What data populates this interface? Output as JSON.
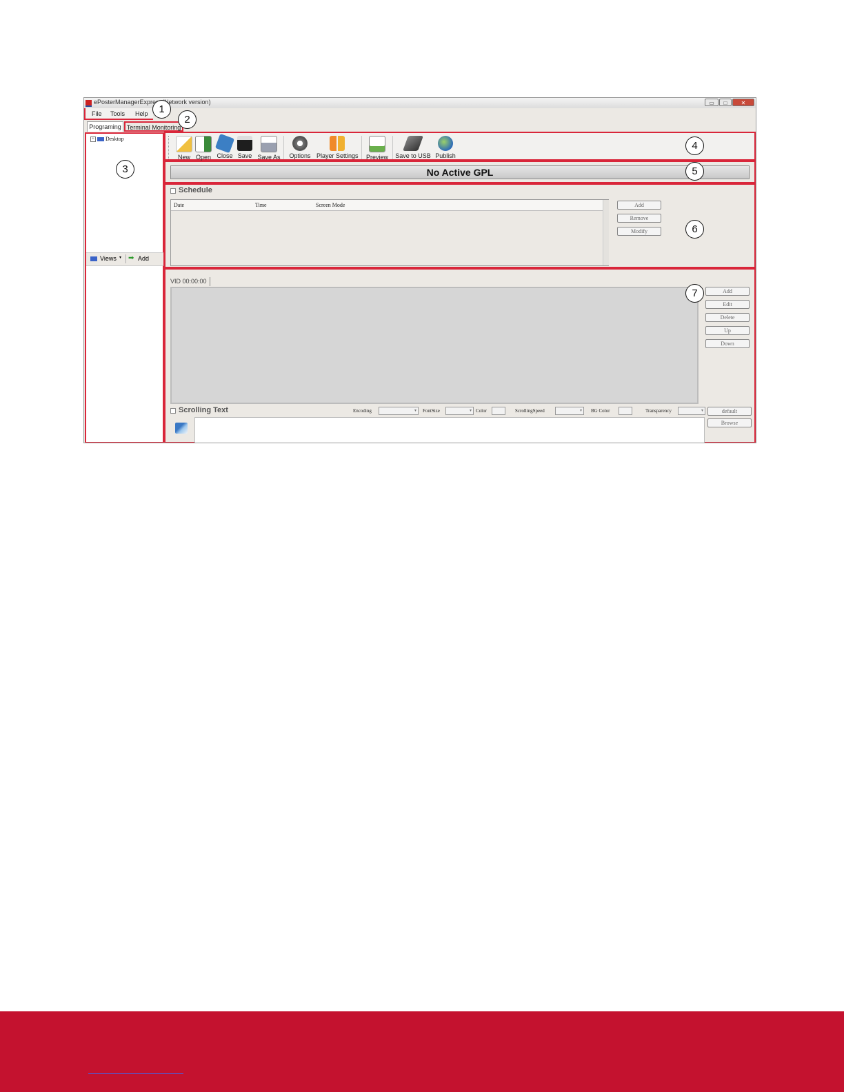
{
  "window": {
    "title": "ePosterManagerExpress(Network version)",
    "controls": {
      "minimize": "▭",
      "maximize": "□",
      "close": "✕"
    }
  },
  "menu": [
    "File",
    "Tools",
    "Help"
  ],
  "tabs": [
    "Programing",
    "Terminal Monitoring"
  ],
  "tree": {
    "root": "Desktop"
  },
  "views_bar": {
    "views_label": "Views",
    "add_label": "Add"
  },
  "toolbar": {
    "buttons": [
      {
        "label": "New",
        "icon": "new-file-icon"
      },
      {
        "label": "Open",
        "icon": "open-file-icon"
      },
      {
        "label": "Close",
        "icon": "close-file-icon"
      },
      {
        "label": "Save",
        "icon": "save-icon"
      },
      {
        "label": "Save As",
        "icon": "save-as-icon"
      },
      {
        "label": "Options",
        "icon": "gear-icon"
      },
      {
        "label": "Player Settings",
        "icon": "player-settings-icon"
      },
      {
        "label": "Preview",
        "icon": "preview-icon"
      },
      {
        "label": "Save to USB",
        "icon": "usb-icon"
      },
      {
        "label": "Publish",
        "icon": "globe-icon"
      }
    ]
  },
  "gpl": {
    "status": "No Active GPL"
  },
  "schedule": {
    "label": "Schedule",
    "columns": [
      "Date",
      "Time",
      "Screen Mode"
    ],
    "buttons": [
      "Add",
      "Remove",
      "Modify"
    ]
  },
  "content": {
    "tab_label": "VID  00:00:00",
    "buttons": [
      "Add",
      "Edit",
      "Delete",
      "Up",
      "Down"
    ]
  },
  "scrolling_text": {
    "label": "Scrolling Text",
    "fields": {
      "encoding": "Encoding",
      "fontsize": "FontSize",
      "color": "Color",
      "scrolling_speed": "ScrollingSpeed",
      "bg_color": "BG Color",
      "transparency": "Transparency"
    },
    "buttons": {
      "default": "default",
      "browse": "Browse"
    }
  },
  "callouts": [
    "1",
    "2",
    "3",
    "4",
    "5",
    "6",
    "7"
  ],
  "colors": {
    "highlight": "#d9263a",
    "footer": "#c4122f"
  }
}
